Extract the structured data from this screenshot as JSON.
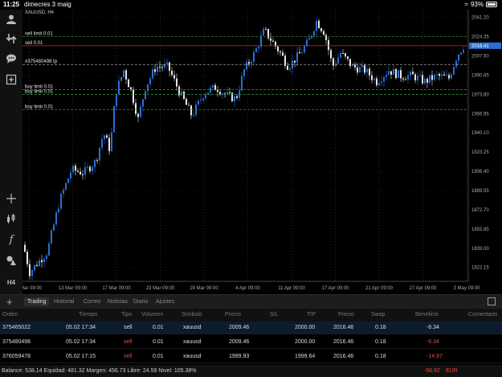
{
  "status": {
    "time": "11:25",
    "date": "dimecres 3 maig",
    "battery": "93%",
    "battery_level": 0.93
  },
  "sidebar": {
    "icons": [
      "user-icon",
      "trade-icon",
      "chat-icon",
      "add-icon",
      "crosshair-icon",
      "indicator-icon",
      "function-icon",
      "objects-icon"
    ],
    "timeframe": "H4"
  },
  "chart": {
    "symbol": "XAUUSD, H4",
    "price_axis": [
      "2041.20",
      "2024.35",
      "2007.50",
      "1990.65",
      "1973.80",
      "1956.95",
      "1940.10",
      "1923.25",
      "1906.40",
      "1889.55",
      "1872.70",
      "1855.85",
      "1839.00",
      "1822.15"
    ],
    "current_price": "2016.41",
    "time_axis": [
      "7 Mar 09:00",
      "13 Mar 09:00",
      "17 Mar 09:00",
      "23 Mar 09:00",
      "29 Mar 09:00",
      "4 Apr 09:00",
      "11 Apr 09:00",
      "17 Apr 09:00",
      "21 Apr 09:00",
      "27 Apr 09:00",
      "3 May 09:00"
    ],
    "order_lines": [
      {
        "label": "sell limit 0.01",
        "price": 2024.35,
        "color": "#2e9a3a",
        "style": "dash"
      },
      {
        "label": "sell 0.01",
        "price": 2016.41,
        "color": "#c0392b",
        "style": "solid"
      },
      {
        "label": "#375480498 tp",
        "price": 2000.0,
        "color": "#c7c7c7",
        "style": "dash"
      },
      {
        "label": "buy limit 0.01",
        "price": 1978.0,
        "color": "#2e9a3a",
        "style": "dash"
      },
      {
        "label": "buy limit 0.01",
        "price": 1973.8,
        "color": "#2e9a3a",
        "style": "dash"
      },
      {
        "label": "buy limit 0.01",
        "price": 1960.5,
        "color": "#2e9a3a",
        "style": "dash"
      }
    ]
  },
  "tabs": [
    "Trading",
    "Historial",
    "Correo",
    "Noticias",
    "Diario",
    "Ajustes"
  ],
  "table": {
    "headers": [
      "Orden",
      "Tiempo",
      "Tipo",
      "Volumen",
      "Símbolo",
      "Precio",
      "S/L",
      "T/P",
      "Precio",
      "Swap",
      "Beneficio",
      "Comentario"
    ],
    "rows": [
      [
        "375465022",
        "05.02 17:34",
        "sell",
        "0.01",
        "xauusd",
        "2009.46",
        "",
        "2000.00",
        "2016.46",
        "0.18",
        "-6.34",
        ""
      ],
      [
        "375480498",
        "05.02 17:34",
        "sell",
        "0.01",
        "xauusd",
        "2009.46",
        "",
        "2000.00",
        "2016.46",
        "0.18",
        "-6.34",
        ""
      ],
      [
        "376059478",
        "05.02 17:15",
        "sell",
        "0.01",
        "xauusd",
        "1999.93",
        "",
        "1999.64",
        "2016.46",
        "0.18",
        "-14.97",
        ""
      ]
    ]
  },
  "footer": {
    "summary": "Balance: 538.14 Equidad: 481.32 Margen: 456.73 Libre: 24.59 Nivel: 105.38%",
    "total": "-56.82",
    "currency": "EUR"
  },
  "colors": {
    "bull": "#2a6fd4",
    "bear": "#e6e6e6",
    "grid": "#2a2a2a",
    "background": "#000000"
  }
}
